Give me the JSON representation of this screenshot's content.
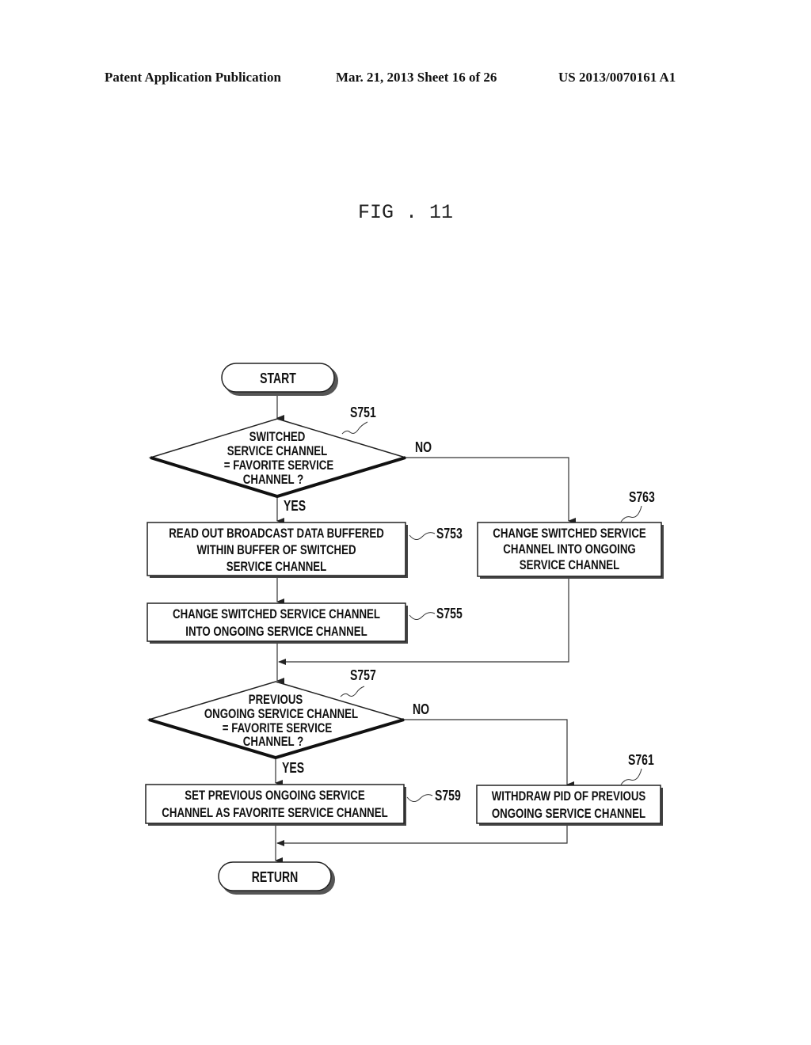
{
  "header": {
    "publication": "Patent Application Publication",
    "date_sheet": "Mar. 21, 2013  Sheet 16 of 26",
    "pub_number": "US 2013/0070161 A1"
  },
  "figure": {
    "title": "FIG . 11"
  },
  "flowchart": {
    "start": "START",
    "end": "RETURN",
    "decisions": [
      {
        "id": "S751",
        "lines": [
          "SWITCHED",
          "SERVICE CHANNEL",
          "= FAVORITE SERVICE",
          "CHANNEL ?"
        ],
        "yes": "YES",
        "no": "NO"
      },
      {
        "id": "S757",
        "lines": [
          "PREVIOUS",
          "ONGOING SERVICE CHANNEL",
          "= FAVORITE SERVICE",
          "CHANNEL ?"
        ],
        "yes": "YES",
        "no": "NO"
      }
    ],
    "processes": [
      {
        "id": "S753",
        "lines": [
          "READ OUT BROADCAST DATA BUFFERED",
          "WITHIN BUFFER OF SWITCHED",
          "SERVICE CHANNEL"
        ]
      },
      {
        "id": "S755",
        "lines": [
          "CHANGE SWITCHED SERVICE CHANNEL",
          "INTO ONGOING SERVICE CHANNEL"
        ]
      },
      {
        "id": "S763",
        "lines": [
          "CHANGE SWITCHED SERVICE",
          "CHANNEL INTO ONGOING",
          "SERVICE CHANNEL"
        ]
      },
      {
        "id": "S759",
        "lines": [
          "SET PREVIOUS ONGOING SERVICE",
          "CHANNEL AS FAVORITE SERVICE CHANNEL"
        ]
      },
      {
        "id": "S761",
        "lines": [
          "WITHDRAW PID OF PREVIOUS",
          "ONGOING SERVICE CHANNEL"
        ]
      }
    ]
  }
}
